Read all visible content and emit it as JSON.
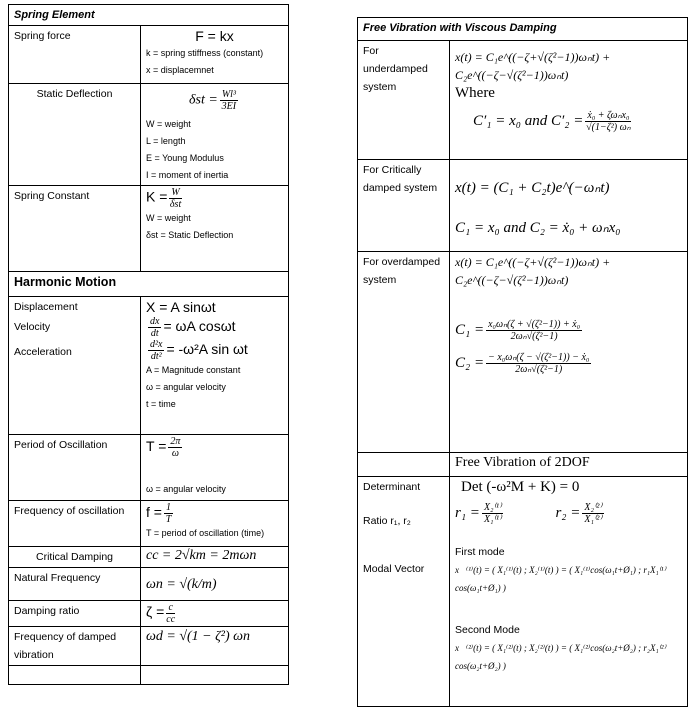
{
  "spring": {
    "title": "Spring Element",
    "force_label": "Spring force",
    "force_eq": "F = kx",
    "force_notes": [
      "k = spring stiffness (constant)",
      "x = displacemnet"
    ],
    "static_label": "Static Deflection",
    "static_lhs": "δst =",
    "static_num": "Wl³",
    "static_den": "3EI",
    "static_notes": [
      "W = weight",
      "L  = length",
      "E = Young Modulus",
      "I = moment of inertia"
    ],
    "const_label": "Spring Constant",
    "const_lhs": "K =",
    "const_num": "W",
    "const_den": "δst",
    "const_notes": [
      "W = weight",
      "δst = Static Deflection"
    ]
  },
  "harmonic": {
    "title": "Harmonic Motion",
    "labels": [
      "Displacement",
      "Velocity",
      "Acceleration"
    ],
    "disp_eq": "X = A sinωt",
    "vel_num": "dx",
    "vel_den": "dt",
    "vel_rhs": "= ωA cosωt",
    "acc_num": "d²x",
    "acc_den": "dt²",
    "acc_rhs": "= -ω²A sin ωt",
    "notes": [
      "A = Magnitude constant",
      "ω = angular velocity",
      "t = time"
    ],
    "period_label": "Period of Oscillation",
    "period_lhs": "T =",
    "period_num": "2π",
    "period_den": "ω",
    "period_note": "ω = angular velocity",
    "freq_label": "Frequency of oscillation",
    "freq_lhs": "f =",
    "freq_num": "1",
    "freq_den": "T",
    "freq_note": "T = period of oscillation (time)",
    "crit_label": "Critical Damping",
    "crit_eq": "cc = 2√km = 2mωn",
    "nat_label": "Natural Frequency",
    "nat_eq": "ωn = √(k/m)",
    "ratio_label": "Damping ratio",
    "ratio_lhs": "ζ =",
    "ratio_num": "c",
    "ratio_den": "cc",
    "damped_label": "Frequency of damped vibration",
    "damped_eq": "ωd =  √(1 − ζ²) ωn"
  },
  "viscous": {
    "title": "Free Vibration with Viscous Damping",
    "under_label": "For underdamped system",
    "under_eq": "x(t) = C₁e^((−ζ+√(ζ²−1))ωₙt) + C₂e^((−ζ−√(ζ²−1))ωₙt)",
    "where": "Where",
    "under_c": "C′₁ = x₀ and C′₂ =",
    "under_c_num": "ẋ₀ + ζωₙx₀",
    "under_c_den": "√(1−ζ²) ωₙ",
    "crit_label": "For Critically damped system",
    "crit_eq": "x(t) = (C₁ + C₂t)e^(−ωₙt)",
    "crit_c": "C₁ = x₀   and  C₂ = ẋ₀ + ωₙx₀",
    "over_label": "For overdamped system",
    "over_eq": "x(t) = C₁e^((−ζ+√(ζ²−1))ωₙt) + C₂e^((−ζ−√(ζ²−1))ωₙt)",
    "over_c1": "C₁ =",
    "over_c1_num": "x₀ωₙ(ζ + √(ζ²−1)) + ẋ₀",
    "over_c1_den": "2ωₙ√(ζ²−1)",
    "over_c2": "C₂ =",
    "over_c2_num": "− x₀ωₙ(ζ − √(ζ²−1)) − ẋ₀",
    "over_c2_den": "2ωₙ√(ζ²−1)"
  },
  "twodof": {
    "title": "Free Vibration of 2DOF",
    "det_label": "Determinant",
    "det_eq": "Det (-ω²M + K) = 0",
    "ratio_label": "Ratio  r₁, r₂",
    "r1": "r₁ =",
    "r1_num": "X₂⁽¹⁾",
    "r1_den": "X₁⁽¹⁾",
    "r2": "r₂ =",
    "r2_num": "X₂⁽²⁾",
    "r2_den": "X₁⁽²⁾",
    "modal_label": "Modal Vector",
    "first": "First mode",
    "first_eq": "x⃗⁽¹⁾(t) = ( X₁⁽¹⁾(t) ; X₂⁽¹⁾(t) ) = ( X₁⁽¹⁾cos(ω₁t+Ø₁) ; r₁X₁⁽¹⁾cos(ω₁t+Ø₁) )",
    "second": "Second Mode",
    "second_eq": "x⃗⁽²⁾(t) = ( X₁⁽²⁾(t) ; X₂⁽²⁾(t) ) = ( X₁⁽²⁾cos(ω₂t+Ø₂) ; r₂X₁⁽²⁾cos(ω₂t+Ø₂) )"
  }
}
